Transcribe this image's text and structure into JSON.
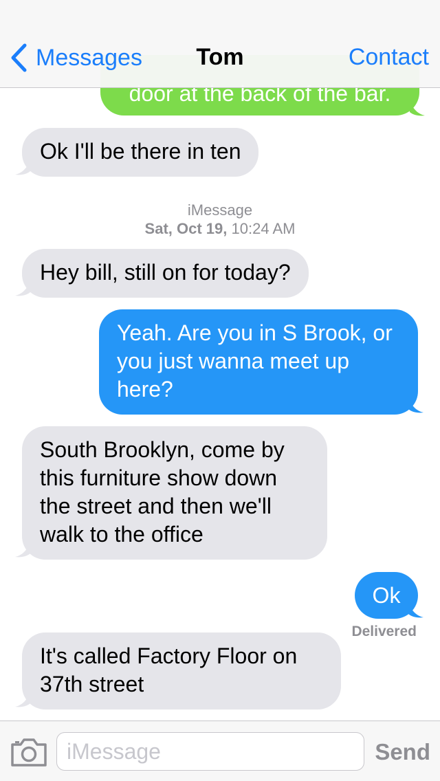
{
  "nav": {
    "back_label": "Messages",
    "title": "Tom",
    "contact_label": "Contact"
  },
  "messages": [
    {
      "text": "door at the back of the bar.",
      "direction": "outgoing",
      "service": "SMS"
    },
    {
      "text": "Ok I'll be there in ten",
      "direction": "incoming"
    },
    {
      "text": "Hey bill, still on for today?",
      "direction": "incoming"
    },
    {
      "text": "Yeah. Are you in S Brook, or you just wanna meet up here?",
      "direction": "outgoing",
      "service": "iMessage"
    },
    {
      "text": "South Brooklyn, come by this furniture show down the street and then we'll walk to the office",
      "direction": "incoming"
    },
    {
      "text": "Ok",
      "direction": "outgoing",
      "service": "iMessage"
    },
    {
      "text": "It's called Factory Floor on 37th street",
      "direction": "incoming"
    }
  ],
  "timestamp": {
    "service": "iMessage",
    "date": "Sat, Oct 19,",
    "time": "10:24 AM"
  },
  "delivery_status": "Delivered",
  "composer": {
    "placeholder": "iMessage",
    "value": "",
    "send_label": "Send"
  },
  "colors": {
    "accent": "#1b7efb",
    "imessage_bubble": "#2596f7",
    "sms_bubble": "#7ddb4b",
    "incoming_bubble": "#e5e5ea"
  },
  "icons": {
    "back": "chevron-left-icon",
    "camera": "camera-icon"
  }
}
